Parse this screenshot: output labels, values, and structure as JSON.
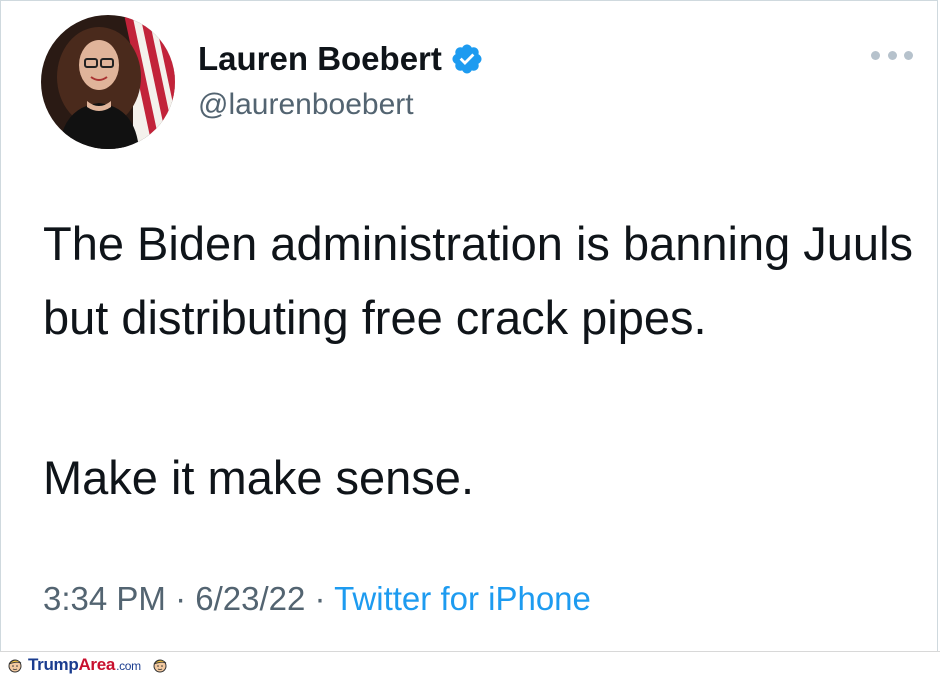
{
  "tweet": {
    "display_name": "Lauren Boebert",
    "handle": "@laurenboebert",
    "text_line1": "The Biden administration is banning Juuls but distributing free crack pipes.",
    "text_line2": "Make it make sense.",
    "time": "3:34 PM",
    "date": "6/23/22",
    "source": "Twitter for iPhone",
    "separator": "·"
  },
  "icons": {
    "verified": "verified-badge-icon",
    "more": "more-options-icon"
  },
  "watermark": {
    "part1": "Trump",
    "part2": "Area",
    "part3": ".com"
  },
  "colors": {
    "link": "#1d9bf0",
    "secondary_text": "#536471",
    "primary_text": "#0f1419",
    "verified": "#1d9bf0"
  }
}
